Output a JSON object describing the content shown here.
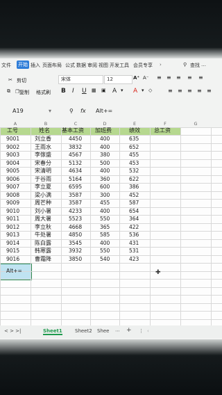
{
  "menu": {
    "file": "文件",
    "start": "开始",
    "insert": "插入",
    "page_layout": "页面布局",
    "formula": "公式",
    "data": "数据",
    "review": "审阅",
    "view": "视图",
    "dev_tools": "开发工具",
    "member": "会员专享",
    "search": "查找",
    "more": "…"
  },
  "ribbon": {
    "cut": "剪切",
    "copy": "复制",
    "format_painter": "格式刷",
    "font_name": "宋体",
    "font_size": "12",
    "bold": "B",
    "italic": "I",
    "underline": "U",
    "fill_color": "A",
    "font_color": "A"
  },
  "formula_bar": {
    "name_box": "A19",
    "fx_label": "fx",
    "content": "Alt+="
  },
  "columns": [
    "A",
    "B",
    "C",
    "D",
    "E",
    "F",
    "G"
  ],
  "table": {
    "headers": [
      "工号",
      "姓名",
      "基本工资",
      "加班费",
      "绩效",
      "总工资"
    ],
    "rows": [
      [
        "9001",
        "刘立香",
        "4450",
        "400",
        "635"
      ],
      [
        "9002",
        "王雨水",
        "3832",
        "400",
        "652"
      ],
      [
        "9003",
        "李傢盛",
        "4567",
        "380",
        "455"
      ],
      [
        "9004",
        "宋春分",
        "5132",
        "500",
        "453"
      ],
      [
        "9005",
        "宋清明",
        "4634",
        "400",
        "532"
      ],
      [
        "9006",
        "于谷雨",
        "5164",
        "360",
        "622"
      ],
      [
        "9007",
        "李立夏",
        "6595",
        "600",
        "386"
      ],
      [
        "9008",
        "梁小满",
        "3587",
        "300",
        "452"
      ],
      [
        "9009",
        "周芒种",
        "3587",
        "455",
        "587"
      ],
      [
        "9010",
        "刘小暑",
        "4233",
        "400",
        "654"
      ],
      [
        "9011",
        "周大暑",
        "5523",
        "550",
        "364"
      ],
      [
        "9012",
        "李立秋",
        "4668",
        "365",
        "422"
      ],
      [
        "9013",
        "牛处暑",
        "4850",
        "585",
        "536"
      ],
      [
        "9014",
        "陈白露",
        "3545",
        "400",
        "431"
      ],
      [
        "9015",
        "韩寒露",
        "3932",
        "550",
        "531"
      ],
      [
        "9016",
        "曹霜降",
        "3850",
        "540",
        "423"
      ]
    ]
  },
  "active_cell_text": "Alt+=",
  "sheet_tabs": {
    "nav": "<  >  >|",
    "tabs": [
      "Sheet1",
      "Sheet2",
      "Shee"
    ],
    "add": "+",
    "more": "⋯"
  },
  "colors": {
    "accent": "#2f7dd8",
    "header_fill": "#b6d88f",
    "active_cell_fill": "#bfe3f1",
    "active_tab": "#1f9a4e"
  }
}
